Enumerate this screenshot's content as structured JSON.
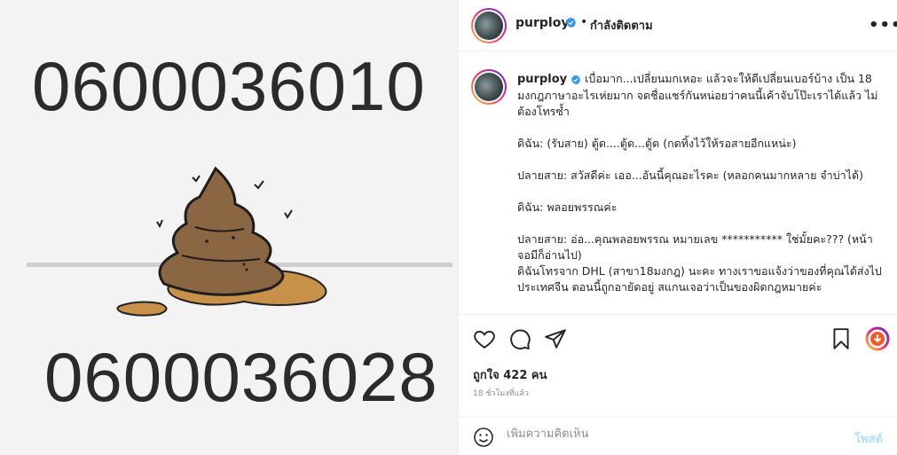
{
  "media": {
    "number_top": "0600036010",
    "number_bottom": "0600036028",
    "image_icon": "poop-emoji-illustration"
  },
  "header": {
    "username": "purploy",
    "dot": "•",
    "follow_status": "กำลังติดตาม",
    "more_icon": "more-horizontal-icon",
    "more_label": "•••"
  },
  "caption": {
    "username": "purploy",
    "text1": "เบื่อมาก...เปลี่ยนมกเหอะ แล้วจะให้ดีเปลี่ยนเบอร์บ้าง เป็น 18 มงกฎภาษาอะไรเห่ยมาก จดชื่อแชร์กันหน่อยว่าคนนี้เค้าจับโป๊ะเราได้แล้ว ไม่ต้องโทรซ้ำ",
    "text2": "ดิฉัน: (รับสาย) ตู้ด....ตู้ด...ตู้ด (กดทิ้งไว้ให้รอสายอีกแหน่ะ)",
    "text3": "ปลายสาย: สวัสดีค่ะ เออ...อันนี้คุณอะไรคะ (หลอกคนมากหลาย จำบ่าได้)",
    "text4": "ดิฉัน: พลอยพรรณค่ะ",
    "text5": "ปลายสาย: อ่อ...คุณพลอยพรรณ หมายเลข *********** ใช่มั้ยคะ??? (หน้าจอมีก็อ่านไป)",
    "text6": "ดิฉันโทรจาก DHL (สาขา18มงกฎ) นะคะ ทางเราขอแจ้งว่าของที่คุณได้ส่งไปประเทศจีน ตอนนี้ถูกอายัดอยู่ สแกนเจอว่าเป็นของผิดกฎหมายค่ะ"
  },
  "actions": {
    "like_icon": "heart-icon",
    "comment_icon": "comment-icon",
    "share_icon": "share-icon",
    "save_icon": "bookmark-icon",
    "download_icon": "download-icon"
  },
  "likes": "ถูกใจ 422 คน",
  "timestamp": "18 ชั่วโมงที่แล้ว",
  "comment": {
    "placeholder": "เพิ่มความคิดเห็น",
    "post_label": "โพสต์",
    "emoji_icon": "smiley-icon"
  },
  "colors": {
    "verified_blue": "#3897f0",
    "post_disabled": "#b2dffc",
    "poop_brown": "#8b6642",
    "poop_puddle": "#c8914a"
  }
}
